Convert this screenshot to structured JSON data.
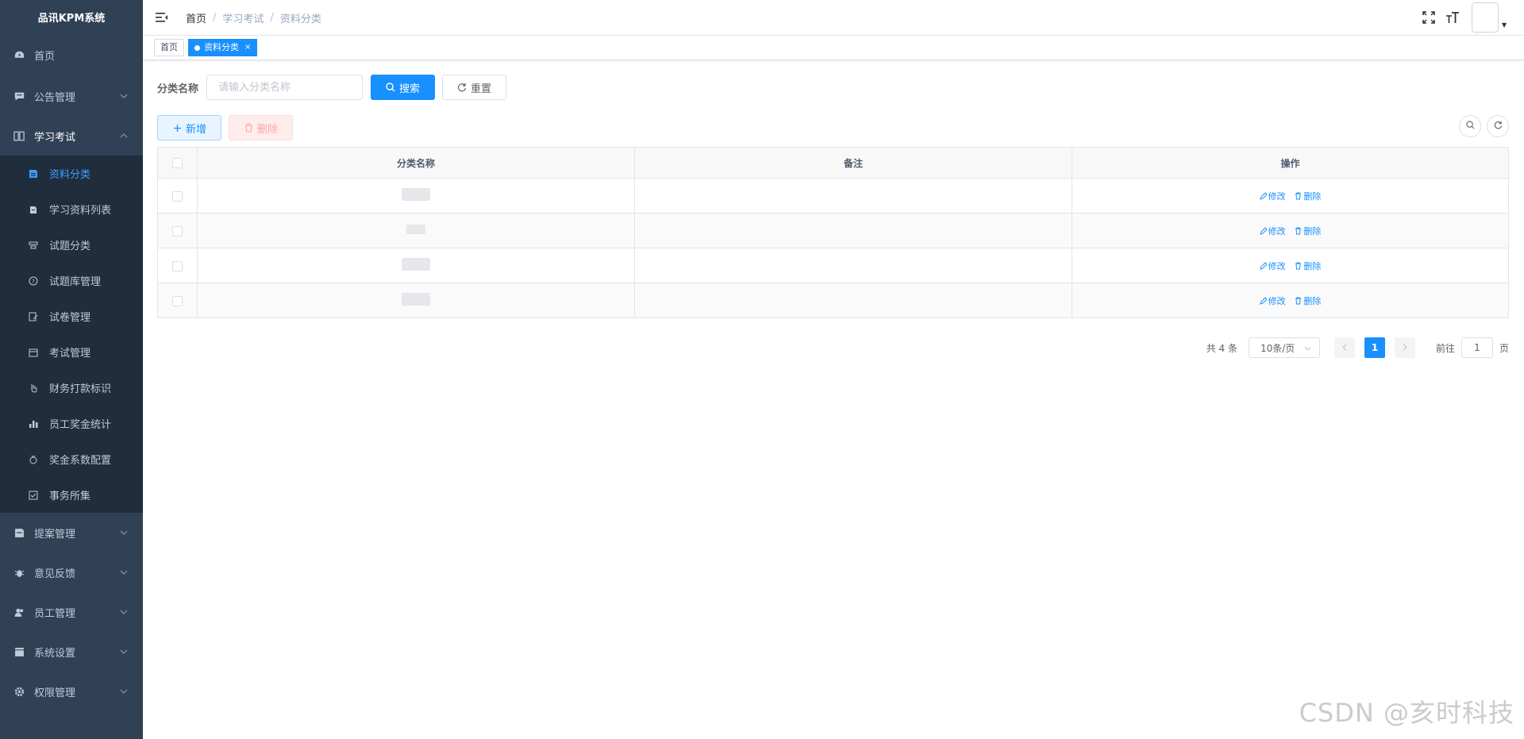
{
  "app": {
    "title": "品讯KPM系统"
  },
  "sidebar": {
    "items": [
      {
        "label": "首页",
        "icon": "dashboard-icon"
      },
      {
        "label": "公告管理",
        "icon": "message-icon",
        "has_caret": true
      },
      {
        "label": "学习考试",
        "icon": "book-icon",
        "has_caret": true,
        "expanded": true
      }
    ],
    "subitems": [
      {
        "label": "资料分类",
        "icon": "document-icon",
        "active": true
      },
      {
        "label": "学习资料列表",
        "icon": "files-icon"
      },
      {
        "label": "试题分类",
        "icon": "category-icon"
      },
      {
        "label": "试题库管理",
        "icon": "question-icon"
      },
      {
        "label": "试卷管理",
        "icon": "edit-paper-icon"
      },
      {
        "label": "考试管理",
        "icon": "calendar-icon"
      },
      {
        "label": "财务打款标识",
        "icon": "hand-icon"
      },
      {
        "label": "员工奖金统计",
        "icon": "bar-chart-icon"
      },
      {
        "label": "奖金系数配置",
        "icon": "award-icon"
      },
      {
        "label": "事务所集",
        "icon": "checkbox-icon"
      }
    ],
    "bottom_items": [
      {
        "label": "提案管理",
        "icon": "proposal-icon"
      },
      {
        "label": "意见反馈",
        "icon": "bug-icon"
      },
      {
        "label": "员工管理",
        "icon": "peoples-icon"
      },
      {
        "label": "系统设置",
        "icon": "clapper-icon"
      },
      {
        "label": "权限管理",
        "icon": "gear-icon"
      }
    ]
  },
  "header": {
    "breadcrumb": [
      "首页",
      "学习考试",
      "资料分类"
    ],
    "separator": "/"
  },
  "tags": {
    "items": [
      {
        "label": "首页",
        "active": false
      },
      {
        "label": "资料分类",
        "active": true,
        "close": "×"
      }
    ]
  },
  "search": {
    "label": "分类名称",
    "placeholder": "请输入分类名称",
    "value": "",
    "search_label": "搜索",
    "reset_label": "重置"
  },
  "toolbar": {
    "add_label": "新增",
    "delete_label": "删除"
  },
  "table": {
    "columns": [
      "分类名称",
      "备注",
      "操作"
    ],
    "rows": [
      {
        "name": "",
        "remark": ""
      },
      {
        "name": "",
        "remark": ""
      },
      {
        "name": "",
        "remark": ""
      },
      {
        "name": "",
        "remark": ""
      }
    ],
    "edit_label": "修改",
    "delete_label": "删除"
  },
  "pagination": {
    "total_text": "共 4 条",
    "page_size": "10条/页",
    "current": "1",
    "goto_prefix": "前往",
    "goto_value": "1",
    "goto_suffix": "页"
  },
  "watermark": "CSDN @亥时科技",
  "colors": {
    "sidebar_bg": "#304156",
    "submenu_bg": "#1f2d3d",
    "accent": "#1890ff",
    "active_text": "#409eff"
  }
}
